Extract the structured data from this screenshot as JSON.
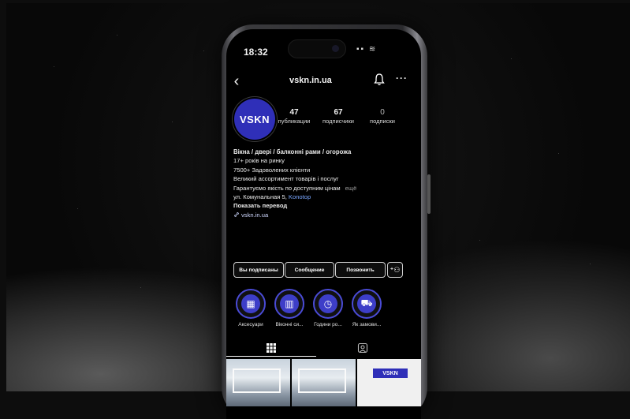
{
  "status_bar": {
    "time": "18:32"
  },
  "profile": {
    "username": "vskn.in.ua",
    "avatar_text": "VSKN",
    "stats": [
      {
        "value": "47",
        "label": "публикации"
      },
      {
        "value": "67",
        "label": "подписчики"
      },
      {
        "value": "0",
        "label": "подписки"
      }
    ],
    "bio": {
      "name": "Вікна / двері / балконні рами / огорожа",
      "lines": [
        "17+ років на ринку",
        "7500+ Задоволених клієнти",
        "Великий ассортимент товарів і послуг",
        "Гарантуємо якість по доступним цінам"
      ],
      "more": "ещё",
      "address_prefix": "ул. Комунальная 5, ",
      "address_link": "Konotop",
      "translate": "Показать перевод",
      "link": "vskn.in.ua"
    }
  },
  "actions": {
    "subscribed": "Вы подписаны",
    "message": "Сообщение",
    "call": "Позвонить"
  },
  "highlights": [
    {
      "label": "Аксесуари",
      "icon": "accessories-icon",
      "glyph": "▦"
    },
    {
      "label": "Віконні си...",
      "icon": "window-icon",
      "glyph": "▥"
    },
    {
      "label": "Години ро...",
      "icon": "clock-icon",
      "glyph": "◷"
    },
    {
      "label": "Як замови...",
      "icon": "truck-icon",
      "glyph": "⛟"
    }
  ],
  "posts": {
    "brand_logo": "VSKN"
  },
  "colors": {
    "brand": "#2f2fb8",
    "highlight_ring": "#4a4bd6"
  }
}
